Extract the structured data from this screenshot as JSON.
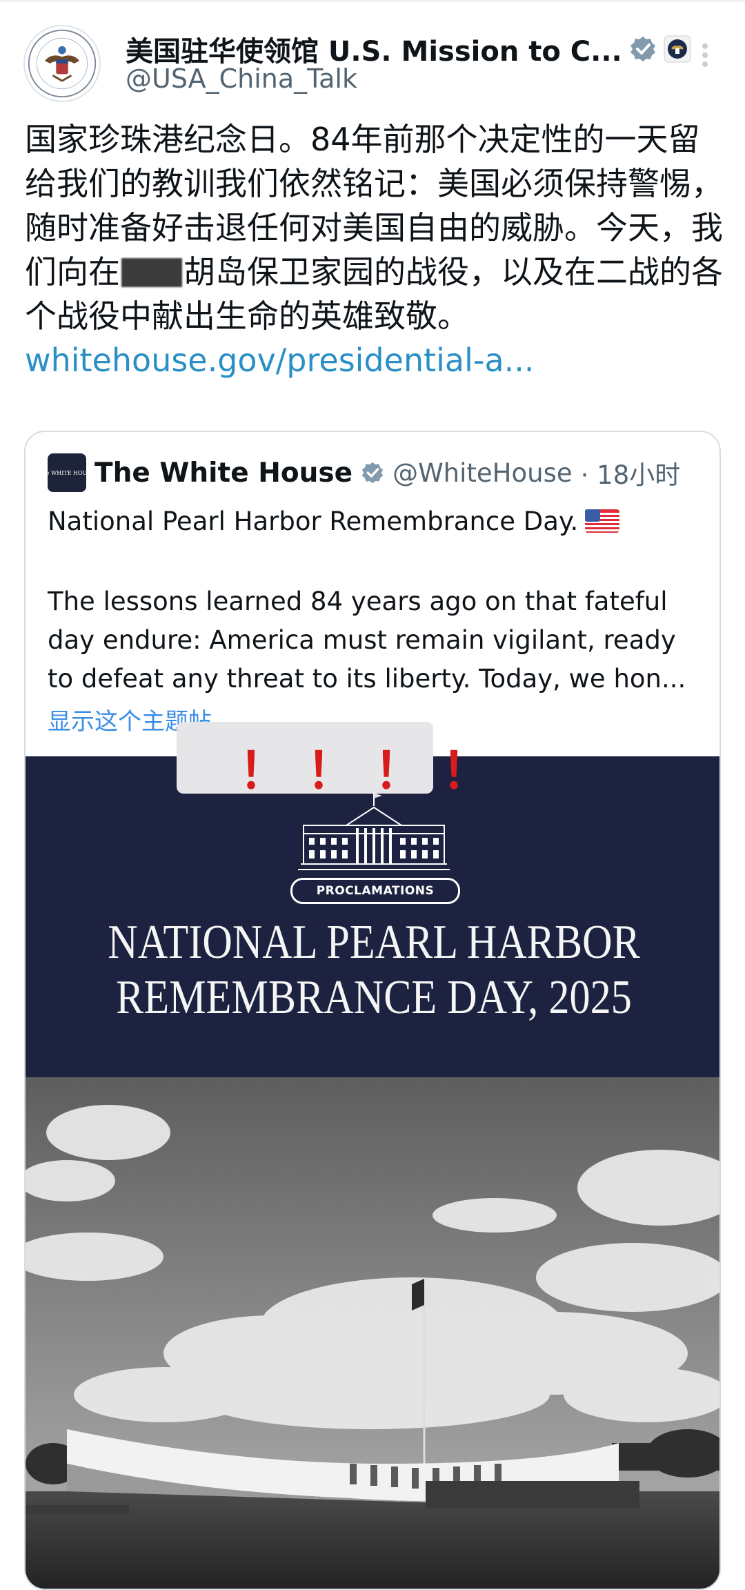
{
  "post": {
    "display_name": "美国驻华使领馆 U.S. Mission to C...",
    "handle": "@USA_China_Talk",
    "text_before": "国家珍珠港纪念日。84年前那个决定性的一天留给我们的教训我们依然铭记：美国必须保持警惕，随时准备好击退任何对美国自由的威胁。今天，我们向在",
    "text_redacted_tail": "胡",
    "text_after": "岛保卫家园的战役，以及在二战的各个战役中献出生命的英雄致敬。",
    "link": "whitehouse.gov/presidential-a...",
    "icons": {
      "verified": "verified-badge-icon",
      "affiliate": "seal-icon",
      "more": "more-options-icon"
    }
  },
  "quote": {
    "display_name": "The White House",
    "handle": "@WhiteHouse",
    "time": "· 18小时",
    "line1": "National Pearl Harbor Remembrance Day.",
    "body": "The lessons learned 84 years ago on that fateful day endure: America must remain vigilant, ready to defeat any threat to its liberty. Today, we hon...",
    "show_more": "显示这个主题帖",
    "avatar_text": "The WHITE HOUSE"
  },
  "image": {
    "marks": "！！！！",
    "pill": "PROCLAMATIONS",
    "title_line1": "NATIONAL PEARL HARBOR",
    "title_line2": "REMEMBRANCE DAY, 2025"
  },
  "colors": {
    "link": "#2b8fc7",
    "banner": "#1c2240",
    "show_more": "#3a8ee6",
    "marks": "#d81b1b"
  }
}
